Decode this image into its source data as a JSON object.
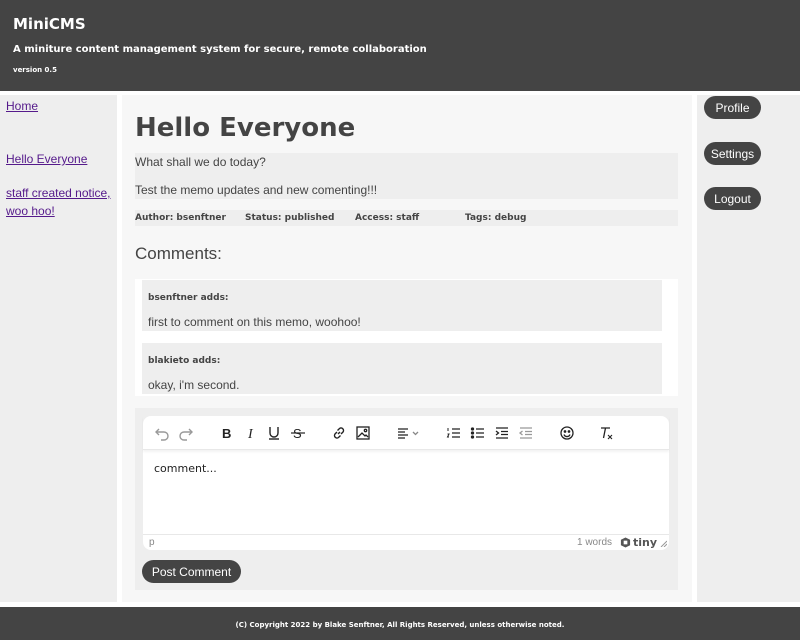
{
  "header": {
    "title": "MiniCMS",
    "tagline": "A miniture content management system for secure, remote collaboration",
    "version": "version 0.5"
  },
  "left_nav": {
    "items": [
      {
        "label": "Home"
      },
      {
        "label": "Hello Everyone"
      },
      {
        "label": "staff created notice, woo hoo!"
      }
    ]
  },
  "post": {
    "title": "Hello Everyone",
    "body_lines": [
      "What shall we do today?",
      "Test the memo updates and new comenting!!!"
    ],
    "meta": {
      "author": "Author: bsenftner",
      "status": "Status: published",
      "access": "Access: staff",
      "tags": "Tags: debug"
    }
  },
  "comments": {
    "heading": "Comments:",
    "items": [
      {
        "author": "bsenftner adds:",
        "text": "first to comment on this memo, woohoo!"
      },
      {
        "author": "blakieto adds:",
        "text": "okay, i'm second."
      }
    ]
  },
  "editor": {
    "toolbar_icons": [
      "undo-icon",
      "redo-icon",
      "bold-icon",
      "italic-icon",
      "underline-icon",
      "strikethrough-icon",
      "link-icon",
      "image-icon",
      "align-icon",
      "numbered-list-icon",
      "bullet-list-icon",
      "indent-icon",
      "outdent-icon",
      "emoticon-icon",
      "clear-format-icon"
    ],
    "content": "comment...",
    "status_path": "p",
    "word_count": "1 words",
    "brand": "tiny",
    "submit_label": "Post Comment"
  },
  "right_nav": {
    "profile_label": "Profile",
    "settings_label": "Settings",
    "logout_label": "Logout"
  },
  "footer": {
    "text": "(C) Copyright 2022 by Blake Senftner, All Rights Reserved, unless otherwise noted."
  },
  "colors": {
    "header_bg": "#444444",
    "panel_bg": "#eeeeee",
    "link": "#551a8b"
  }
}
